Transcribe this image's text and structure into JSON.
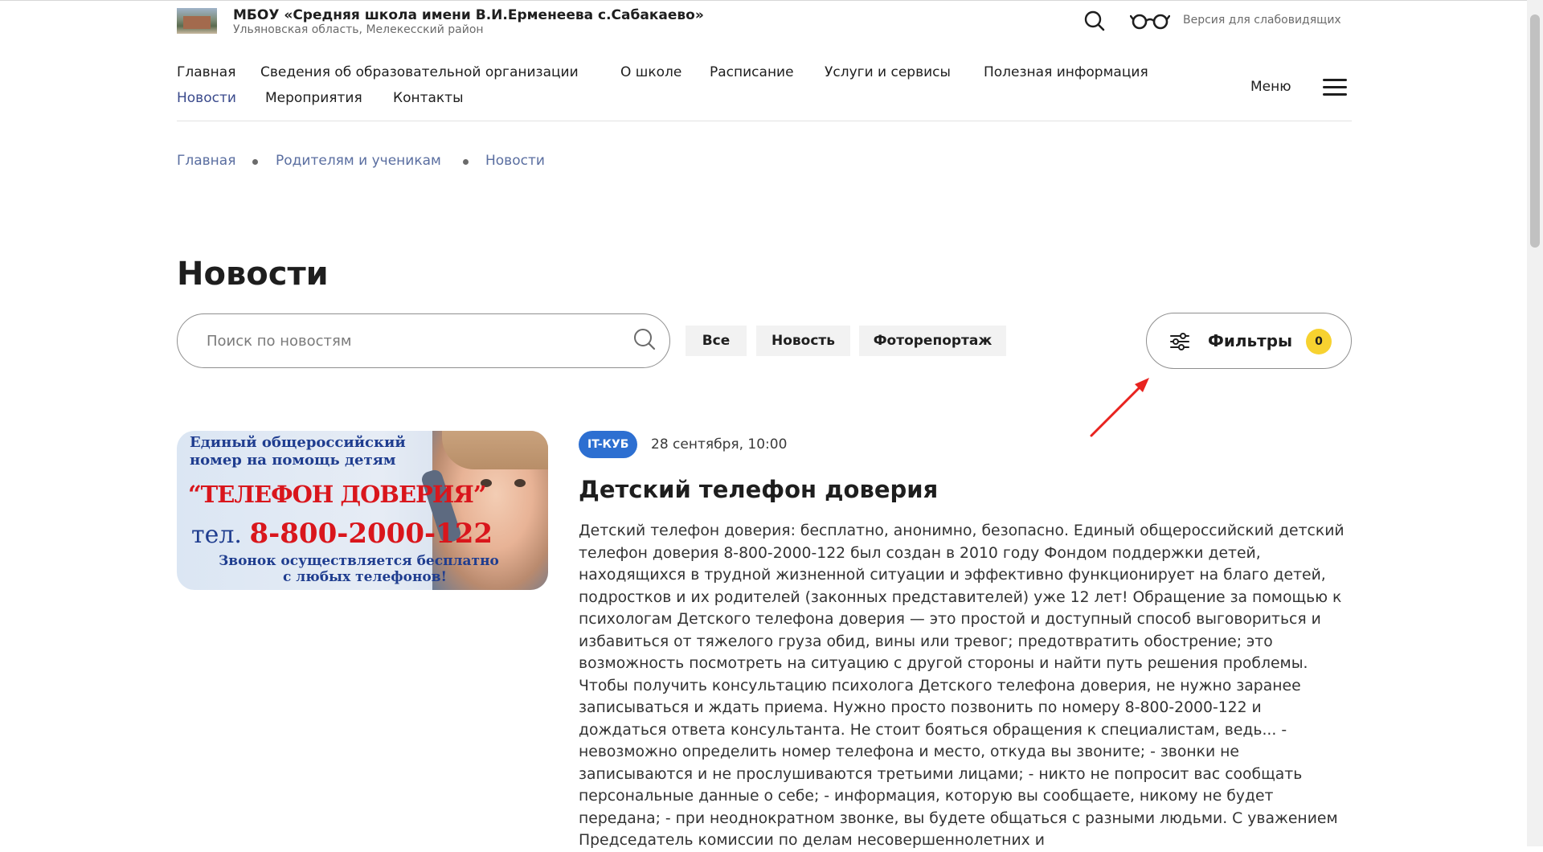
{
  "header": {
    "school_name": "МБОУ «Средняя школа имени В.И.Ерменеева с.Сабакаево»",
    "school_region": "Ульяновская область, Мелекесский район",
    "search_icon": "search-icon",
    "vision_icon": "glasses-icon",
    "vision_label": "Версия для слабовидящих"
  },
  "nav": {
    "items": [
      {
        "label": "Главная"
      },
      {
        "label": "Сведения об образовательной организации"
      },
      {
        "label": "О школе"
      },
      {
        "label": "Расписание"
      },
      {
        "label": "Услуги и сервисы"
      },
      {
        "label": "Полезная информация"
      },
      {
        "label": "Новости",
        "active": true
      },
      {
        "label": "Мероприятия"
      },
      {
        "label": "Контакты"
      }
    ],
    "menu_label": "Меню",
    "menu_icon": "hamburger-icon",
    "active_color": "#3a4a8c"
  },
  "breadcrumb": [
    "Главная",
    "Родителям и ученикам",
    "Новости"
  ],
  "page": {
    "title": "Новости",
    "search_placeholder": "Поиск по новостям",
    "search_value": "",
    "chips": [
      "Все",
      "Новость",
      "Фоторепортаж"
    ],
    "filters_label": "Фильтры",
    "filters_count": "0",
    "filters_icon": "sliders-icon",
    "badge_color": "#f7d230"
  },
  "annotation": {
    "arrow_color": "#e8231f"
  },
  "news": [
    {
      "image_text": {
        "line1": "Единый общероссийский",
        "line2": "номер на помощь детям",
        "line3": "“ТЕЛЕФОН ДОВЕРИЯ”",
        "line4_prefix": "тел.",
        "line4_phone": "8-800-2000-122",
        "line5": "Звонок осуществляется бесплатно",
        "line6": "с любых телефонов!"
      },
      "tag": "IT-КУБ",
      "tag_color": "#2d6fd1",
      "date": "28 сентября, 10:00",
      "title": "Детский телефон доверия",
      "body": "Детский телефон доверия: бесплатно, анонимно, безопасно. Единый общероссийский детский телефон доверия 8-800-2000-122 был создан в 2010 году Фондом поддержки детей, находящихся в трудной жизненной ситуации и эффективно функционирует на благо детей, подростков и их родителей (законных представителей) уже 12 лет! Обращение за помощью к психологам Детского телефона доверия — это простой и доступный способ выговориться и избавиться от тяжелого груза обид, вины или тревог; предотвратить обострение; это возможность посмотреть на ситуацию с другой стороны и найти путь решения проблемы. Чтобы получить консультацию психолога Детского телефона доверия, не нужно заранее записываться и ждать приема. Нужно просто позвонить по номеру 8-800-2000-122 и дождаться ответа консультанта. Не стоит бояться обращения к специалистам, ведь... - невозможно определить номер телефона и место, откуда вы звоните; - звонки не записываются и не прослушиваются третьими лицами; - никто не попросит вас сообщать персональные данные о себе; - информация, которую вы сообщаете, никому не будет передана; - при неоднократном звонке, вы будете общаться с разными людьми. С уважением Председатель комиссии по делам несовершеннолетних и"
    }
  ]
}
